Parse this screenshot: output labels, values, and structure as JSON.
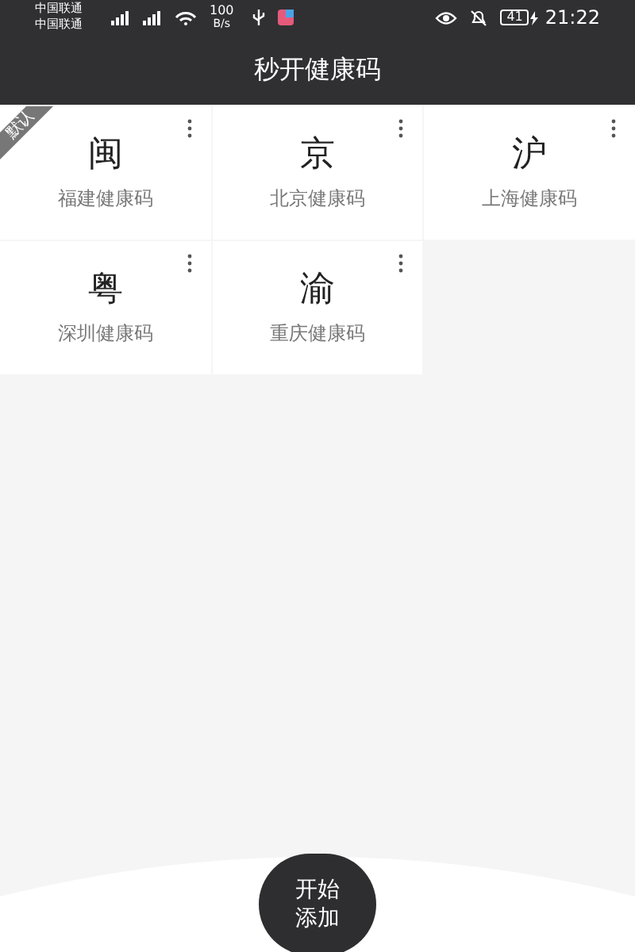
{
  "status_bar": {
    "carriers": [
      "中国联通",
      "中国联通"
    ],
    "speed_value": "100",
    "speed_unit": "B/s",
    "battery": "41",
    "time": "21:22"
  },
  "title": "秒开健康码",
  "cards": [
    {
      "glyph": "闽",
      "name": "福建健康码",
      "default": true,
      "badge": "默认"
    },
    {
      "glyph": "京",
      "name": "北京健康码",
      "default": false
    },
    {
      "glyph": "沪",
      "name": "上海健康码",
      "default": false
    },
    {
      "glyph": "粤",
      "name": "深圳健康码",
      "default": false
    },
    {
      "glyph": "渝",
      "name": "重庆健康码",
      "default": false
    }
  ],
  "add_button": "开始添加"
}
